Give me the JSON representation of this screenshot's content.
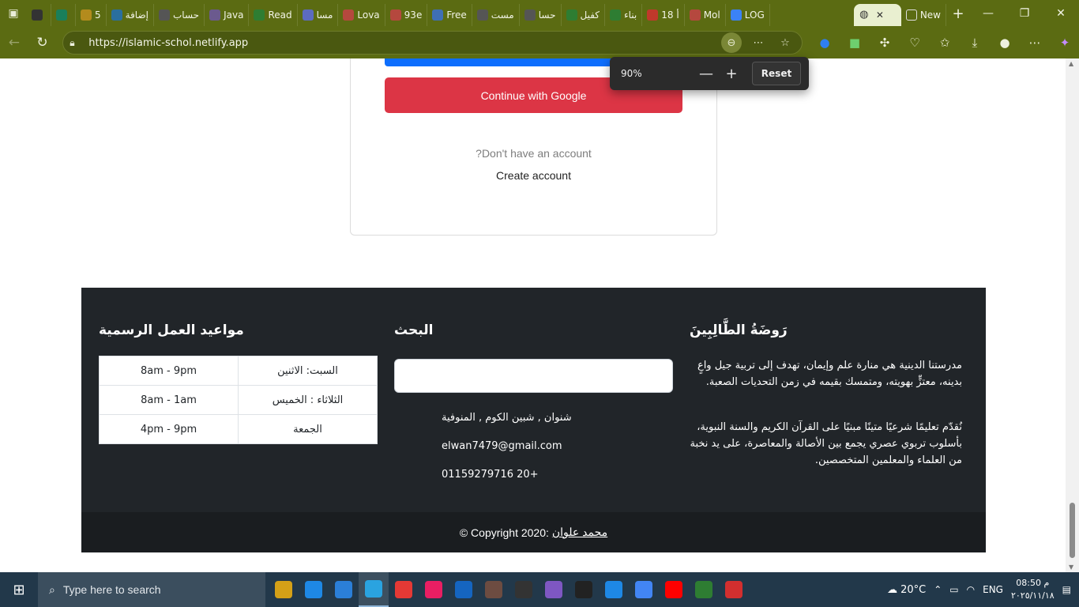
{
  "browser": {
    "tabs": [
      {
        "label": "",
        "color": "#333333"
      },
      {
        "label": "",
        "color": "#1a7f5a"
      },
      {
        "label": "5",
        "color": "#b38b1d"
      },
      {
        "label": "إضافة",
        "color": "#2a6f9e"
      },
      {
        "label": "حساب",
        "color": "#555555"
      },
      {
        "label": "Java",
        "color": "#6b5a8e"
      },
      {
        "label": "Read",
        "color": "#2e7d32"
      },
      {
        "label": "مسا",
        "color": "#5c6bc0"
      },
      {
        "label": "Lova",
        "color": "#b5483e"
      },
      {
        "label": "93e",
        "color": "#b5483e"
      },
      {
        "label": "Free",
        "color": "#3f6fb5"
      },
      {
        "label": "مست",
        "color": "#555555"
      },
      {
        "label": "حسا",
        "color": "#555555"
      },
      {
        "label": "كفيل",
        "color": "#2e7d32"
      },
      {
        "label": "بناء",
        "color": "#2e7d32"
      },
      {
        "label": "18 أ",
        "color": "#c0392b"
      },
      {
        "label": "Mol",
        "color": "#b5483e"
      },
      {
        "label": "LOG",
        "color": "#3b82f6"
      }
    ],
    "active_tab_close": "✕",
    "new_tab_label": "New",
    "url": "https://islamic-schol.netlify.app",
    "zoom": {
      "percent": "90%",
      "minus": "—",
      "plus": "+",
      "reset": "Reset"
    }
  },
  "login": {
    "google_button": "Continue with Google",
    "no_account": "?Don't have an account",
    "create_account": "Create account"
  },
  "footer": {
    "about": {
      "title": "رَوضَةُ الطَّالِبِينَ",
      "p1": "مدرستنا الدينية هي منارة علم وإيمان، تهدف إلى تربية جيل واعٍ بدينه، معتزٍّ بهويته، ومتمسك بقيمه في زمن التحديات الصعبة.",
      "p2": "نُقدّم تعليمًا شرعيًا متينًا مبنيًا على القرآن الكريم والسنة النبوية، بأسلوب تربوي عصري يجمع بين الأصالة والمعاصرة، على يد نخبة من العلماء والمعلمين المتخصصين."
    },
    "search": {
      "title": "البحث",
      "placeholder": "",
      "address": "شنوان , شبين الكوم , المنوفية",
      "email": "elwan7479@gmail.com",
      "phone": "+20 01159279716"
    },
    "hours": {
      "title": "مواعيد العمل الرسمية",
      "rows": [
        {
          "day": "السبت: الاثنين",
          "time": "8am - 9pm"
        },
        {
          "day": "الثلاثاء : الخميس",
          "time": "8am - 1am"
        },
        {
          "day": "الجمعة",
          "time": "4pm - 9pm"
        }
      ]
    },
    "copyright_prefix": "© Copyright 2020:",
    "copyright_author": "محمد علوان"
  },
  "taskbar": {
    "search_placeholder": "Type here to search",
    "weather": "20°C",
    "language": "ENG",
    "time": "08:50 م",
    "date": "٢٠٢٥/١١/١٨",
    "app_colors": [
      "#d4a017",
      "#1e88e5",
      "#2b7fd8",
      "#2aa3e0",
      "#e53935",
      "#e91e63",
      "#1565c0",
      "#6d4c41",
      "#333333",
      "#7e57c2",
      "#222222",
      "#1e88e5",
      "#4285f4",
      "#ff0000",
      "#2e7d32",
      "#d32f2f"
    ]
  }
}
